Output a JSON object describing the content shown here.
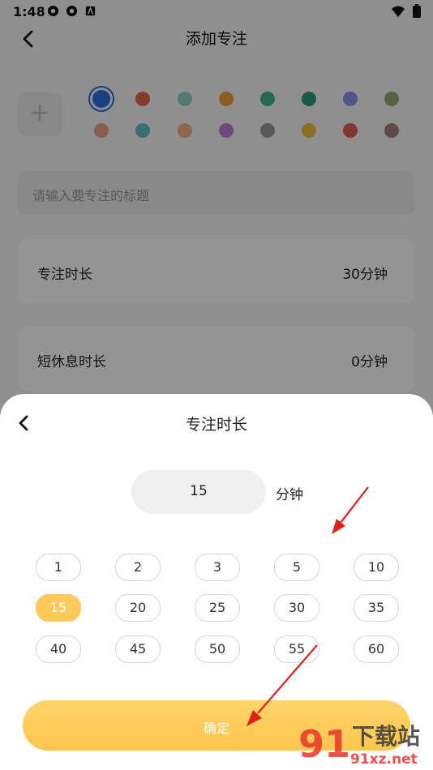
{
  "status": {
    "time": "1:48"
  },
  "header": {
    "title": "添加专注"
  },
  "colors": {
    "row1": [
      "#2f6fe0",
      "#e2664a",
      "#8fd0cc",
      "#f0a23c",
      "#3fb98b",
      "#2e9880",
      "#8f8ff0",
      "#8fb070"
    ],
    "row2": [
      "#e8a389",
      "#5fc1c4",
      "#f3b27e",
      "#c47ad6",
      "#9a9a9a",
      "#f0c13b",
      "#e65c57",
      "#a5807a"
    ],
    "selected_index": 0
  },
  "title_input": {
    "placeholder": "请输入要专注的标题"
  },
  "settings": [
    {
      "label": "专注时长",
      "value": "30分钟"
    },
    {
      "label": "短休息时长",
      "value": "0分钟"
    }
  ],
  "sheet": {
    "title": "专注时长",
    "current_value": "15",
    "unit": "分钟",
    "options": [
      "1",
      "2",
      "3",
      "5",
      "10",
      "15",
      "20",
      "25",
      "30",
      "35",
      "40",
      "45",
      "50",
      "55",
      "60"
    ],
    "selected_option": "15",
    "confirm_label": "确定",
    "accent": "#ffc95b"
  },
  "watermark": {
    "brand": "下载站",
    "url": "91xz.net"
  }
}
